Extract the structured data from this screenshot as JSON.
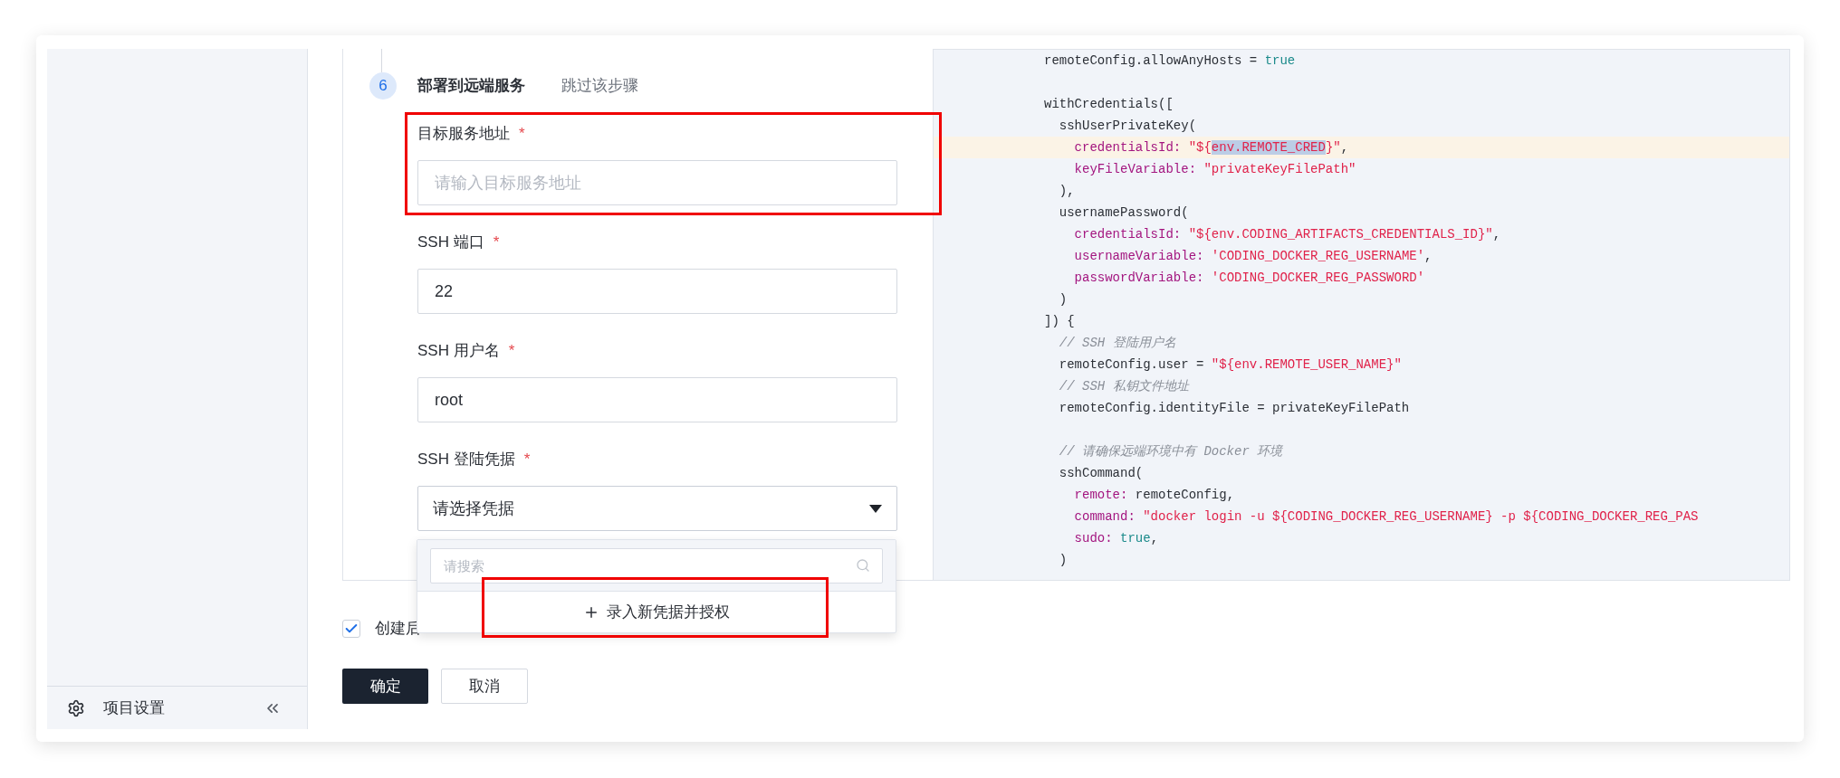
{
  "sidebar": {
    "footer": {
      "label": "项目设置"
    }
  },
  "step": {
    "number": "6",
    "title": "部署到远端服务",
    "skip": "跳过该步骤"
  },
  "fields": [
    {
      "kind": "input",
      "label": "目标服务地址",
      "required_mark": "*",
      "placeholder": "请输入目标服务地址",
      "highlighted": true
    },
    {
      "kind": "input",
      "label": "SSH 端口",
      "required_mark": "*",
      "value": "22",
      "highlighted": false
    },
    {
      "kind": "input",
      "label": "SSH 用户名",
      "required_mark": "*",
      "value": "root",
      "highlighted": false
    },
    {
      "kind": "select",
      "label": "SSH 登陆凭据",
      "required_mark": "*",
      "value": "请选择凭据",
      "highlighted": false,
      "expanded": true
    }
  ],
  "dropdown": {
    "search_placeholder": "请搜索",
    "action": {
      "label": "录入新凭据并授权",
      "highlighted": true
    }
  },
  "checkbox": {
    "label": "创建后",
    "checked": true
  },
  "buttons": [
    {
      "label": "确定",
      "kind": "primary"
    },
    {
      "label": "取消",
      "kind": "secondary"
    }
  ],
  "code": [
    {
      "highlighted": false,
      "tokens": [
        {
          "kind": "plain",
          "text": "remoteConfig.allowAnyHosts = "
        },
        {
          "kind": "literal",
          "text": "true"
        }
      ]
    },
    {
      "kind": "blank"
    },
    {
      "highlighted": false,
      "tokens": [
        {
          "kind": "plain",
          "text": "withCredentials(["
        }
      ]
    },
    {
      "highlighted": false,
      "tokens": [
        {
          "kind": "plain",
          "text": "  sshUserPrivateKey("
        }
      ]
    },
    {
      "highlighted": true,
      "tokens": [
        {
          "kind": "key",
          "text": "    credentialsId: "
        },
        {
          "kind": "string",
          "text": "\"${"
        },
        {
          "kind": "string",
          "text": "env.REMOTE_CRED",
          "selected": true
        },
        {
          "kind": "string",
          "text": "}\""
        },
        {
          "kind": "plain",
          "text": ","
        }
      ]
    },
    {
      "highlighted": false,
      "tokens": [
        {
          "kind": "key",
          "text": "    keyFileVariable: "
        },
        {
          "kind": "string",
          "text": "\"privateKeyFilePath\""
        }
      ]
    },
    {
      "highlighted": false,
      "tokens": [
        {
          "kind": "plain",
          "text": "  ),"
        }
      ]
    },
    {
      "highlighted": false,
      "tokens": [
        {
          "kind": "plain",
          "text": "  usernamePassword("
        }
      ]
    },
    {
      "highlighted": false,
      "tokens": [
        {
          "kind": "key",
          "text": "    credentialsId: "
        },
        {
          "kind": "string",
          "text": "\"${env.CODING_ARTIFACTS_CREDENTIALS_ID}\""
        },
        {
          "kind": "plain",
          "text": ","
        }
      ]
    },
    {
      "highlighted": false,
      "tokens": [
        {
          "kind": "key",
          "text": "    usernameVariable: "
        },
        {
          "kind": "string",
          "text": "'CODING_DOCKER_REG_USERNAME'"
        },
        {
          "kind": "plain",
          "text": ","
        }
      ]
    },
    {
      "highlighted": false,
      "tokens": [
        {
          "kind": "key",
          "text": "    passwordVariable: "
        },
        {
          "kind": "string",
          "text": "'CODING_DOCKER_REG_PASSWORD'"
        }
      ]
    },
    {
      "highlighted": false,
      "tokens": [
        {
          "kind": "plain",
          "text": "  )"
        }
      ]
    },
    {
      "highlighted": false,
      "tokens": [
        {
          "kind": "plain",
          "text": "]) {"
        }
      ]
    },
    {
      "highlighted": false,
      "tokens": [
        {
          "kind": "comment",
          "text": "  // SSH 登陆用户名"
        }
      ]
    },
    {
      "highlighted": false,
      "tokens": [
        {
          "kind": "plain",
          "text": "  remoteConfig.user = "
        },
        {
          "kind": "string",
          "text": "\"${env.REMOTE_USER_NAME}\""
        }
      ]
    },
    {
      "highlighted": false,
      "tokens": [
        {
          "kind": "comment",
          "text": "  // SSH 私钥文件地址"
        }
      ]
    },
    {
      "highlighted": false,
      "tokens": [
        {
          "kind": "plain",
          "text": "  remoteConfig.identityFile = privateKeyFilePath"
        }
      ]
    },
    {
      "kind": "blank"
    },
    {
      "highlighted": false,
      "tokens": [
        {
          "kind": "comment",
          "text": "  // 请确保远端环境中有 Docker 环境"
        }
      ]
    },
    {
      "highlighted": false,
      "tokens": [
        {
          "kind": "plain",
          "text": "  sshCommand("
        }
      ]
    },
    {
      "highlighted": false,
      "tokens": [
        {
          "kind": "key",
          "text": "    remote: "
        },
        {
          "kind": "plain",
          "text": "remoteConfig,"
        }
      ]
    },
    {
      "highlighted": false,
      "tokens": [
        {
          "kind": "key",
          "text": "    command: "
        },
        {
          "kind": "string",
          "text": "\"docker login -u ${CODING_DOCKER_REG_USERNAME} -p ${CODING_DOCKER_REG_PAS"
        }
      ]
    },
    {
      "highlighted": false,
      "tokens": [
        {
          "kind": "key",
          "text": "    sudo: "
        },
        {
          "kind": "literal",
          "text": "true"
        },
        {
          "kind": "plain",
          "text": ","
        }
      ]
    },
    {
      "highlighted": false,
      "tokens": [
        {
          "kind": "plain",
          "text": "  )"
        }
      ]
    }
  ]
}
